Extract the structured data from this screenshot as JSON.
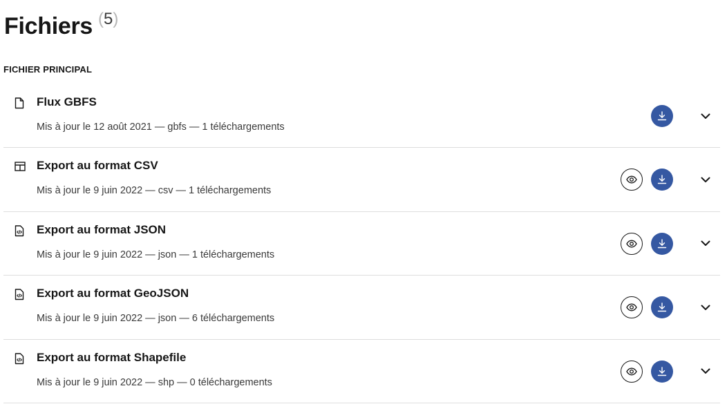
{
  "header": {
    "title": "Fichiers",
    "count_open": "(",
    "count": "5",
    "count_close": ")"
  },
  "section": {
    "label": "FICHIER PRINCIPAL"
  },
  "colors": {
    "primary": "#3558a2",
    "text": "#161616",
    "muted": "#3a3a3a",
    "divider": "#dddddd"
  },
  "files": [
    {
      "title": "Flux GBFS",
      "meta": "Mis à jour le 12 août 2021 — gbfs — 1 téléchargements",
      "icon": "file-icon",
      "preview": false
    },
    {
      "title": "Export au format CSV",
      "meta": "Mis à jour le 9 juin 2022 — csv — 1 téléchargements",
      "icon": "table-icon",
      "preview": true
    },
    {
      "title": "Export au format JSON",
      "meta": "Mis à jour le 9 juin 2022 — json — 1 téléchargements",
      "icon": "code-file-icon",
      "preview": true
    },
    {
      "title": "Export au format GeoJSON",
      "meta": "Mis à jour le 9 juin 2022 — json — 6 téléchargements",
      "icon": "code-file-icon",
      "preview": true
    },
    {
      "title": "Export au format Shapefile",
      "meta": "Mis à jour le 9 juin 2022 — shp — 0 téléchargements",
      "icon": "code-file-icon",
      "preview": true
    }
  ]
}
